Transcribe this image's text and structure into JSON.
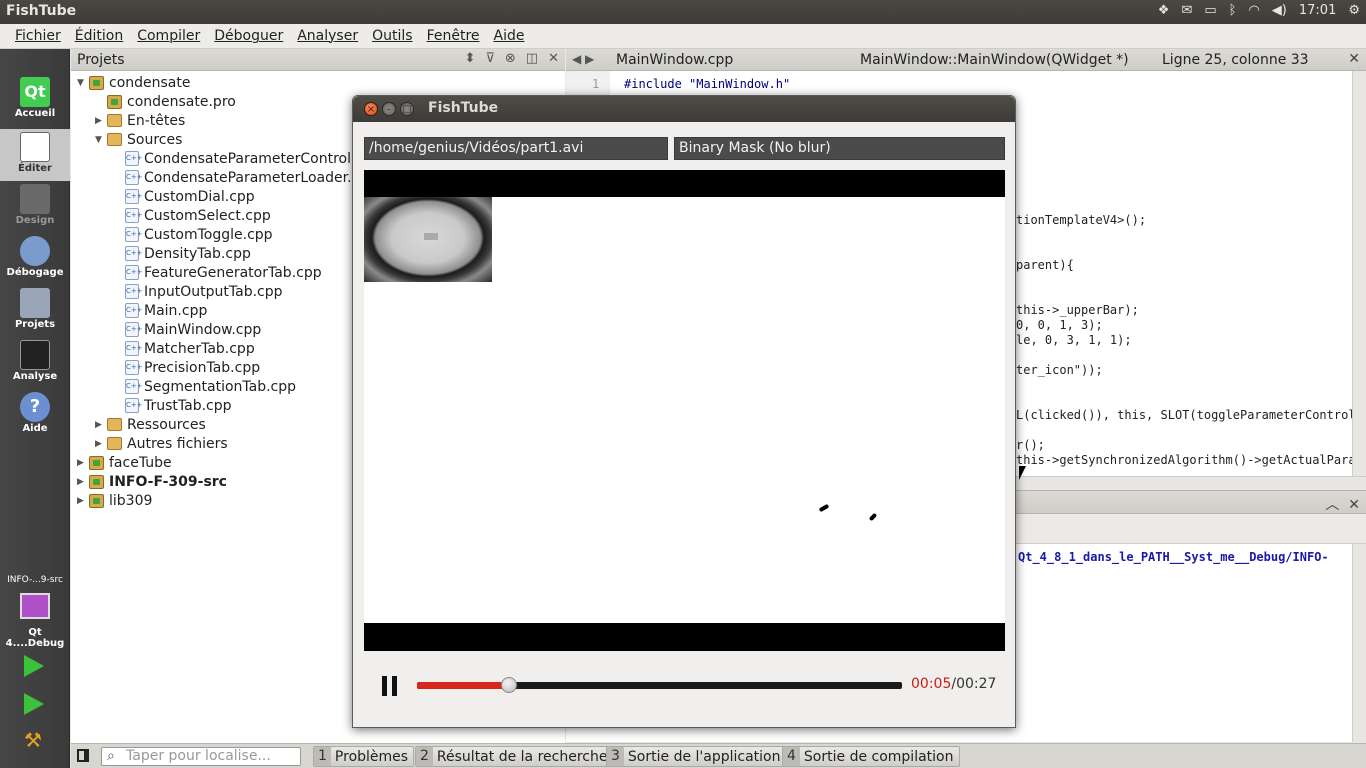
{
  "system": {
    "app_title": "FishTube",
    "tray": {
      "time": "17:01"
    }
  },
  "menubar": [
    "Fichier",
    "Édition",
    "Compiler",
    "Déboguer",
    "Analyser",
    "Outils",
    "Fenêtre",
    "Aide"
  ],
  "modebar": {
    "modes": [
      {
        "label": "Accueil",
        "icon": "qt-logo-icon"
      },
      {
        "label": "Éditer",
        "icon": "document-icon",
        "active": true
      },
      {
        "label": "Design",
        "icon": "pen-icon",
        "disabled": true
      },
      {
        "label": "Débogage",
        "icon": "bug-icon"
      },
      {
        "label": "Projets",
        "icon": "book-icon"
      },
      {
        "label": "Analyse",
        "icon": "chart-icon"
      },
      {
        "label": "Aide",
        "icon": "question-icon"
      }
    ],
    "target_project": "INFO-...9-src",
    "target_kit": "Qt 4....Debug"
  },
  "projects": {
    "title": "Projets",
    "tree": [
      {
        "label": "condensate",
        "level": 0,
        "expanded": true,
        "icon": "project"
      },
      {
        "label": "condensate.pro",
        "level": 1,
        "icon": "project"
      },
      {
        "label": "En-têtes",
        "level": 1,
        "collapsed": true,
        "icon": "headers-folder"
      },
      {
        "label": "Sources",
        "level": 1,
        "expanded": true,
        "icon": "sources-folder"
      },
      {
        "label": "CondensateParameterControl.cpp",
        "level": 2,
        "icon": "cpp"
      },
      {
        "label": "CondensateParameterLoader.cpp",
        "level": 2,
        "icon": "cpp"
      },
      {
        "label": "CustomDial.cpp",
        "level": 2,
        "icon": "cpp"
      },
      {
        "label": "CustomSelect.cpp",
        "level": 2,
        "icon": "cpp"
      },
      {
        "label": "CustomToggle.cpp",
        "level": 2,
        "icon": "cpp"
      },
      {
        "label": "DensityTab.cpp",
        "level": 2,
        "icon": "cpp"
      },
      {
        "label": "FeatureGeneratorTab.cpp",
        "level": 2,
        "icon": "cpp"
      },
      {
        "label": "InputOutputTab.cpp",
        "level": 2,
        "icon": "cpp"
      },
      {
        "label": "Main.cpp",
        "level": 2,
        "icon": "cpp"
      },
      {
        "label": "MainWindow.cpp",
        "level": 2,
        "icon": "cpp"
      },
      {
        "label": "MatcherTab.cpp",
        "level": 2,
        "icon": "cpp"
      },
      {
        "label": "PrecisionTab.cpp",
        "level": 2,
        "icon": "cpp"
      },
      {
        "label": "SegmentationTab.cpp",
        "level": 2,
        "icon": "cpp"
      },
      {
        "label": "TrustTab.cpp",
        "level": 2,
        "icon": "cpp"
      },
      {
        "label": "Ressources",
        "level": 1,
        "collapsed": true,
        "icon": "resources-folder"
      },
      {
        "label": "Autres fichiers",
        "level": 1,
        "collapsed": true,
        "icon": "other-folder"
      },
      {
        "label": "faceTube",
        "level": 0,
        "collapsed": true,
        "icon": "project"
      },
      {
        "label": "INFO-F-309-src",
        "level": 0,
        "collapsed": true,
        "icon": "project",
        "bold": true
      },
      {
        "label": "lib309",
        "level": 0,
        "collapsed": true,
        "icon": "project"
      }
    ]
  },
  "editor": {
    "file": "MainWindow.cpp",
    "function": "MainWindow::MainWindow(QWidget *)",
    "position": "Ligne 25, colonne 33",
    "first_line_number": "1",
    "first_line": "#include \"MainWindow.h\"",
    "visible_code": [
      "tionTemplateV4>();",
      "parent){",
      "this->_upperBar);",
      "0, 0, 1, 3);",
      "le, 0, 3, 1, 1);",
      "ter_icon\"));",
      "L(clicked()), this, SLOT(toggleParameterControl",
      "r();",
      "this->getSynchronizedAlgorithm()->getActualPara"
    ]
  },
  "output": {
    "line": "Qt_4_8_1_dans_le_PATH__Syst_me__Debug/INFO-"
  },
  "statusbar": {
    "search_placeholder": "Taper pour localise...",
    "tabs": [
      {
        "num": "1",
        "label": "Problèmes"
      },
      {
        "num": "2",
        "label": "Résultat de la recherche"
      },
      {
        "num": "3",
        "label": "Sortie de l'application"
      },
      {
        "num": "4",
        "label": "Sortie de compilation"
      }
    ]
  },
  "fishtube": {
    "title": "FishTube",
    "file_path": "/home/genius/Vidéos/part1.avi",
    "mode": "Binary Mask (No blur)",
    "time_current": "00:05",
    "time_total": "00:27",
    "progress_fraction": 0.19
  }
}
